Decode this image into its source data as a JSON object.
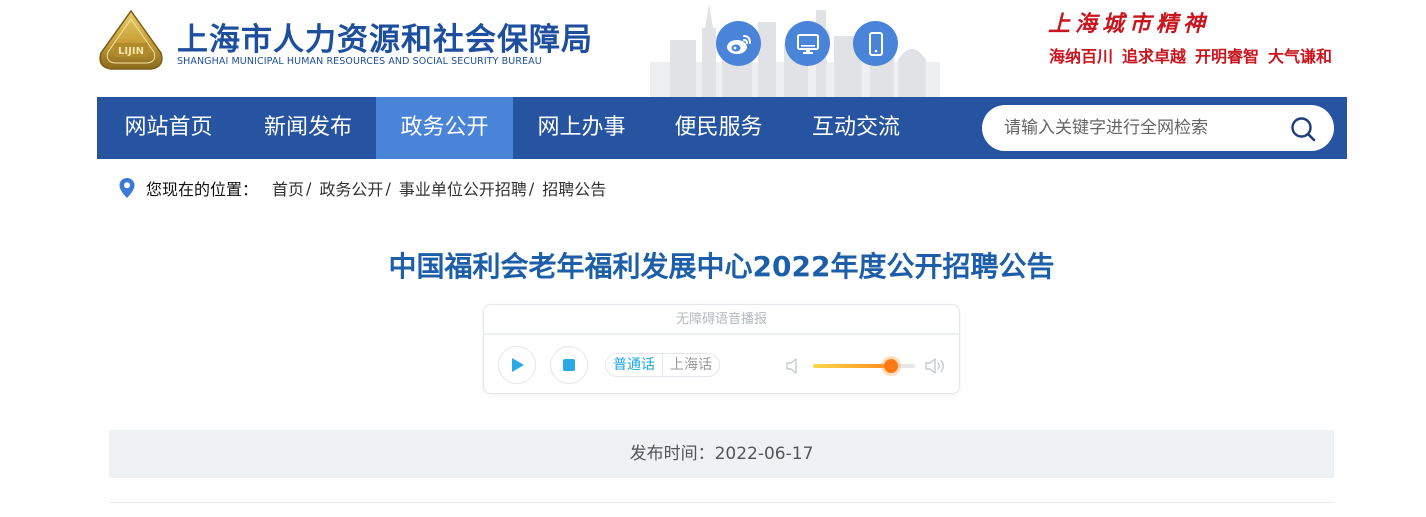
{
  "header": {
    "title_cn": "上海市人力资源和社会保障局",
    "title_en": "SHANGHAI MUNICIPAL HUMAN RESOURCES AND SOCIAL SECURITY BUREAU",
    "logo_text": "LIJIN",
    "icons": [
      "weibo-icon",
      "computer-icon",
      "mobile-icon"
    ],
    "spirit_title": "上海城市精神",
    "spirit_phrases": [
      "海纳百川",
      "追求卓越",
      "开明睿智",
      "大气谦和"
    ]
  },
  "nav": {
    "items": [
      "网站首页",
      "新闻发布",
      "政务公开",
      "网上办事",
      "便民服务",
      "互动交流"
    ],
    "active_index": 2,
    "search_placeholder": "请输入关键字进行全网检索"
  },
  "breadcrumb": {
    "label": "您现在的位置：",
    "items": [
      "首页",
      "政务公开",
      "事业单位公开招聘",
      "招聘公告"
    ],
    "separator": "/"
  },
  "article": {
    "title": "中国福利会老年福利发展中心2022年度公开招聘公告",
    "publish_label": "发布时间：",
    "publish_date": "2022-06-17"
  },
  "player": {
    "header": "无障碍语音播报",
    "lang_mandarin": "普通话",
    "lang_shanghainese": "上海话",
    "selected_lang": "普通话",
    "volume": 0.76
  },
  "colors": {
    "nav_bg": "#2654a1",
    "nav_active": "#4a84d8",
    "brand_blue": "#1d4f9e",
    "title_blue": "#1d5ea8",
    "spirit_red": "#c9151e",
    "accent_cyan": "#1da7e0",
    "volume_orange": "#ff7a12"
  }
}
